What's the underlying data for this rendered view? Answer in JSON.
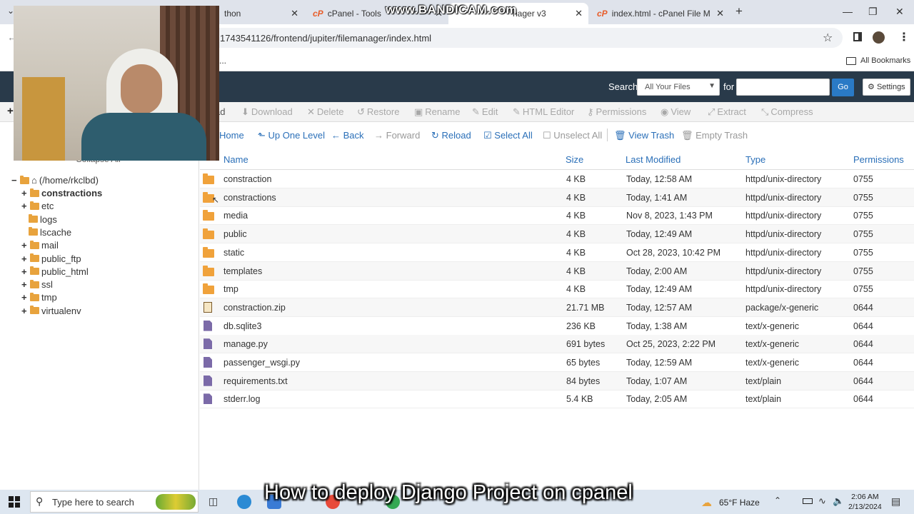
{
  "browser": {
    "tabs": [
      {
        "title": "thon",
        "active": false
      },
      {
        "title": "cPanel - Tools",
        "active": false
      },
      {
        "title": "nager v3",
        "active": true
      },
      {
        "title": "index.html - cPanel File Manag",
        "active": false
      }
    ],
    "new_tab": "+",
    "address": "1743541126/frontend/jupiter/filemanager/index.html",
    "bookmarks_label": "All Bookmarks",
    "bookmark_ellipsis": "..."
  },
  "watermark": "www.BANDICAM.com",
  "header": {
    "search_label": "Search",
    "search_scope": "All Your Files",
    "for_label": "for",
    "go_label": "Go",
    "settings_label": "Settings"
  },
  "toolbar": {
    "items": [
      {
        "icon": "upload-icon",
        "label": "ad"
      },
      {
        "icon": "download-icon",
        "label": "Download"
      },
      {
        "icon": "delete-icon",
        "label": "Delete"
      },
      {
        "icon": "restore-icon",
        "label": "Restore"
      },
      {
        "icon": "rename-icon",
        "label": "Rename"
      },
      {
        "icon": "edit-icon",
        "label": "Edit"
      },
      {
        "icon": "html-editor-icon",
        "label": "HTML Editor"
      },
      {
        "icon": "key-icon",
        "label": "Permissions"
      },
      {
        "icon": "eye-icon",
        "label": "View"
      },
      {
        "icon": "extract-icon",
        "label": "Extract"
      },
      {
        "icon": "compress-icon",
        "label": "Compress"
      }
    ]
  },
  "nav": {
    "home": "Home",
    "up_one_level": "Up One Level",
    "back": "Back",
    "forward": "Forward",
    "reload": "Reload",
    "select_all": "Select All",
    "unselect_all": "Unselect All",
    "view_trash": "View Trash",
    "empty_trash": "Empty Trash"
  },
  "sidebar": {
    "collapse_label": "Collapse All",
    "root": "(/home/rkclbd)",
    "items": [
      {
        "label": "constractions",
        "expandable": true,
        "bold": true
      },
      {
        "label": "etc",
        "expandable": true,
        "bold": false
      },
      {
        "label": "logs",
        "expandable": false,
        "bold": false
      },
      {
        "label": "lscache",
        "expandable": false,
        "bold": false
      },
      {
        "label": "mail",
        "expandable": true,
        "bold": false
      },
      {
        "label": "public_ftp",
        "expandable": true,
        "bold": false
      },
      {
        "label": "public_html",
        "expandable": true,
        "bold": false
      },
      {
        "label": "ssl",
        "expandable": true,
        "bold": false
      },
      {
        "label": "tmp",
        "expandable": true,
        "bold": false
      },
      {
        "label": "virtualenv",
        "expandable": true,
        "bold": false
      }
    ]
  },
  "table": {
    "headers": {
      "name": "Name",
      "size": "Size",
      "modified": "Last Modified",
      "type": "Type",
      "perms": "Permissions"
    },
    "rows": [
      {
        "kind": "folder",
        "name": "constraction",
        "size": "4 KB",
        "modified": "Today, 12:58 AM",
        "type": "httpd/unix-directory",
        "perms": "0755"
      },
      {
        "kind": "folder",
        "name": "constractions",
        "size": "4 KB",
        "modified": "Today, 1:41 AM",
        "type": "httpd/unix-directory",
        "perms": "0755"
      },
      {
        "kind": "folder",
        "name": "media",
        "size": "4 KB",
        "modified": "Nov 8, 2023, 1:43 PM",
        "type": "httpd/unix-directory",
        "perms": "0755"
      },
      {
        "kind": "folder",
        "name": "public",
        "size": "4 KB",
        "modified": "Today, 12:49 AM",
        "type": "httpd/unix-directory",
        "perms": "0755"
      },
      {
        "kind": "folder",
        "name": "static",
        "size": "4 KB",
        "modified": "Oct 28, 2023, 10:42 PM",
        "type": "httpd/unix-directory",
        "perms": "0755"
      },
      {
        "kind": "folder",
        "name": "templates",
        "size": "4 KB",
        "modified": "Today, 2:00 AM",
        "type": "httpd/unix-directory",
        "perms": "0755"
      },
      {
        "kind": "folder",
        "name": "tmp",
        "size": "4 KB",
        "modified": "Today, 12:49 AM",
        "type": "httpd/unix-directory",
        "perms": "0755"
      },
      {
        "kind": "zip",
        "name": "constraction.zip",
        "size": "21.71 MB",
        "modified": "Today, 12:57 AM",
        "type": "package/x-generic",
        "perms": "0644"
      },
      {
        "kind": "file",
        "name": "db.sqlite3",
        "size": "236 KB",
        "modified": "Today, 1:38 AM",
        "type": "text/x-generic",
        "perms": "0644"
      },
      {
        "kind": "file",
        "name": "manage.py",
        "size": "691 bytes",
        "modified": "Oct 25, 2023, 2:22 PM",
        "type": "text/x-generic",
        "perms": "0644"
      },
      {
        "kind": "file",
        "name": "passenger_wsgi.py",
        "size": "65 bytes",
        "modified": "Today, 12:59 AM",
        "type": "text/x-generic",
        "perms": "0644"
      },
      {
        "kind": "file",
        "name": "requirements.txt",
        "size": "84 bytes",
        "modified": "Today, 1:07 AM",
        "type": "text/plain",
        "perms": "0644"
      },
      {
        "kind": "file",
        "name": "stderr.log",
        "size": "5.4 KB",
        "modified": "Today, 2:05 AM",
        "type": "text/plain",
        "perms": "0644"
      }
    ]
  },
  "taskbar": {
    "search_placeholder": "Type here to search",
    "weather": "65°F  Haze",
    "time": "2:06 AM",
    "date": "2/13/2024"
  },
  "subtitle": "How to deploy Django Project on cpanel",
  "colors": {
    "header_bg": "#293a4a",
    "link_blue": "#2a6fb8",
    "folder": "#f0a23b",
    "file_icon": "#7b6aa8",
    "go_button": "#2a7ac6"
  }
}
